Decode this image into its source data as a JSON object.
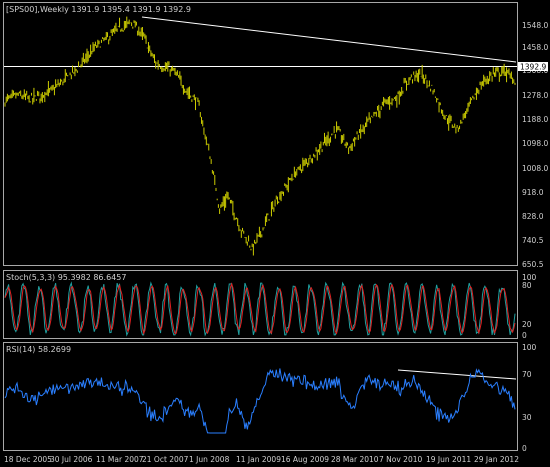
{
  "colors": {
    "background": "#000000",
    "frame": "#a8a8a8",
    "price": "#cccc00",
    "stoch_main": "#20a0a0",
    "stoch_signal": "#e02020",
    "rsi": "#2a7fff",
    "trendline": "#ffffff",
    "text": "#cfcfcf"
  },
  "main_panel": {
    "header": "[SPS00],Weekly  1391.9 1395.4 1391.9 1392.9",
    "current_price_label": "1392.9",
    "y_ticks": [
      "1548.0",
      "1458.0",
      "1368.0",
      "1278.0",
      "1188.0",
      "1098.0",
      "1008.0",
      "918.0",
      "828.0",
      "740.5",
      "650.5"
    ]
  },
  "stoch_panel": {
    "header": "Stoch(5,3,3) 95.3982 86.6457",
    "y_ticks": [
      "100",
      "80",
      "20",
      "0"
    ]
  },
  "rsi_panel": {
    "header": "RSI(14) 58.2699",
    "y_ticks": [
      "100",
      "70",
      "30",
      "0"
    ]
  },
  "x_axis": {
    "labels": [
      "18 Dec 2005",
      "30 Jul 2006",
      "11 Mar 2007",
      "21 Oct 2007",
      "1 Jun 2008",
      "11 Jan 2009",
      "16 Aug 2009",
      "28 Mar 2010",
      "7 Nov 2010",
      "19 Jun 2011",
      "29 Jan 2012"
    ]
  },
  "chart_data": {
    "type": "bar",
    "timeframe": "Weekly",
    "symbol": "SPS00",
    "ohlc_last": {
      "open": 1391.9,
      "high": 1395.4,
      "low": 1391.9,
      "close": 1392.9
    },
    "x_dates": [
      "18 Dec 2005",
      "30 Jul 2006",
      "11 Mar 2007",
      "21 Oct 2007",
      "1 Jun 2008",
      "11 Jan 2009",
      "16 Aug 2009",
      "28 Mar 2010",
      "7 Nov 2010",
      "19 Jun 2011",
      "29 Jan 2012"
    ],
    "approx_close_path": [
      [
        "18 Dec 2005",
        1260
      ],
      [
        "30 Jul 2006",
        1260
      ],
      [
        "11 Mar 2007",
        1400
      ],
      [
        "21 Oct 2007",
        1555
      ],
      [
        "1 Jun 2008",
        1380
      ],
      [
        "11 Jan 2009",
        850
      ],
      [
        "16 Aug 2009",
        1000
      ],
      [
        "28 Mar 2010",
        1150
      ],
      [
        "7 Nov 2010",
        1220
      ],
      [
        "19 Jun 2011",
        1270
      ],
      [
        "29 Jan 2012",
        1330
      ]
    ],
    "ylim": [
      650.5,
      1548.0
    ],
    "indicators": {
      "stochastic": {
        "params": "5,3,3",
        "main": 95.3982,
        "signal": 86.6457,
        "levels": [
          20,
          80
        ]
      },
      "rsi": {
        "period": 14,
        "value": 58.2699,
        "levels": [
          30,
          70
        ]
      }
    }
  }
}
